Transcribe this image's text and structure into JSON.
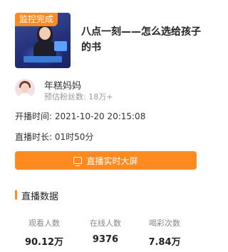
{
  "live": {
    "status_tag": "监控完成",
    "title": "八点一刻——怎么选给孩子的书"
  },
  "author": {
    "name": "年糕妈妈",
    "fans_label": "预估粉丝数",
    "fans_value": "18万+"
  },
  "info": {
    "start_label": "开播时间:",
    "start_value": "2021-10-20 20:15:08",
    "duration_label": "直播时长:",
    "duration_value": "01时50分"
  },
  "cta": {
    "label": "直播实时大屏",
    "icon": "tv-icon"
  },
  "section": {
    "title": "直播数据"
  },
  "stats": [
    {
      "label": "观看人数",
      "value": "90.12万"
    },
    {
      "label": "在线人数",
      "value": "9376"
    },
    {
      "label": "喝彩次数",
      "value": "7.84万"
    }
  ],
  "colors": {
    "accent": "#ff8a1f"
  }
}
